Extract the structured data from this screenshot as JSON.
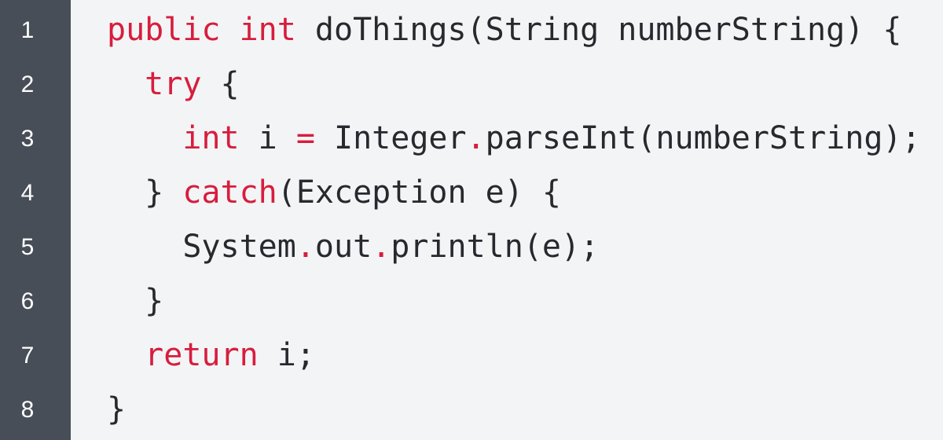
{
  "editor": {
    "colors": {
      "background": "#f3f4f6",
      "gutter": "#474e57",
      "line_number": "#ffffff",
      "text": "#26292d",
      "keyword": "#d71d3d"
    },
    "line_numbers": [
      "1",
      "2",
      "3",
      "4",
      "5",
      "6",
      "7",
      "8"
    ],
    "lines": [
      {
        "indent": "",
        "tokens": [
          {
            "t": "public",
            "k": "kw"
          },
          {
            "t": " ",
            "k": "plain"
          },
          {
            "t": "int",
            "k": "kw"
          },
          {
            "t": " doThings(String numberString) {",
            "k": "plain"
          }
        ]
      },
      {
        "indent": "  ",
        "tokens": [
          {
            "t": "try",
            "k": "kw"
          },
          {
            "t": " {",
            "k": "plain"
          }
        ]
      },
      {
        "indent": "    ",
        "tokens": [
          {
            "t": "int",
            "k": "kw"
          },
          {
            "t": " i ",
            "k": "plain"
          },
          {
            "t": "=",
            "k": "op"
          },
          {
            "t": " Integer",
            "k": "plain"
          },
          {
            "t": ".",
            "k": "op"
          },
          {
            "t": "parseInt(numberString);",
            "k": "plain"
          }
        ]
      },
      {
        "indent": "  ",
        "tokens": [
          {
            "t": "} ",
            "k": "plain"
          },
          {
            "t": "catch",
            "k": "kw"
          },
          {
            "t": "(Exception e) {",
            "k": "plain"
          }
        ]
      },
      {
        "indent": "    ",
        "tokens": [
          {
            "t": "System",
            "k": "plain"
          },
          {
            "t": ".",
            "k": "op"
          },
          {
            "t": "out",
            "k": "plain"
          },
          {
            "t": ".",
            "k": "op"
          },
          {
            "t": "println(e);",
            "k": "plain"
          }
        ]
      },
      {
        "indent": "  ",
        "tokens": [
          {
            "t": "}",
            "k": "plain"
          }
        ]
      },
      {
        "indent": "  ",
        "tokens": [
          {
            "t": "return",
            "k": "kw"
          },
          {
            "t": " i;",
            "k": "plain"
          }
        ]
      },
      {
        "indent": "",
        "tokens": [
          {
            "t": "}",
            "k": "plain"
          }
        ]
      }
    ]
  }
}
